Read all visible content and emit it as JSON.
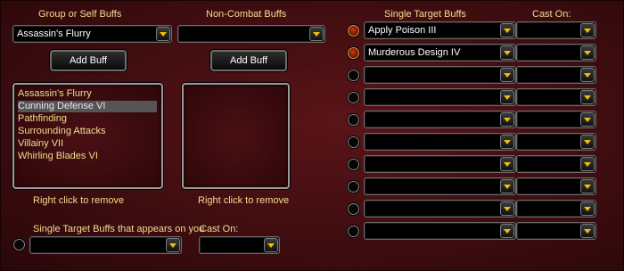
{
  "headers": {
    "group_buffs": "Group or Self Buffs",
    "noncombat_buffs": "Non-Combat Buffs",
    "single_target_buffs": "Single Target Buffs",
    "cast_on": "Cast On:",
    "single_target_on_you": "Single Target Buffs that appears on you",
    "cast_on_bottom": "Cast On:"
  },
  "group_dropdown": {
    "value": "Assassin's Flurry"
  },
  "noncombat_dropdown": {
    "value": ""
  },
  "buttons": {
    "add_buff_group": "Add Buff",
    "add_buff_noncombat": "Add Buff"
  },
  "group_list": {
    "items": [
      "Assassin's Flurry",
      "Cunning Defense VI",
      "Pathfinding",
      "Surrounding Attacks",
      "Villainy VII",
      "Whirling Blades VI"
    ],
    "selected_index": 1
  },
  "noncombat_list": {
    "items": []
  },
  "notes": {
    "remove_left": "Right click to remove",
    "remove_right": "Right click to remove"
  },
  "single_target_rows": [
    {
      "buff": "Apply Poison III",
      "cast_on": "",
      "active": true
    },
    {
      "buff": "Murderous Design IV",
      "cast_on": "",
      "active": true
    },
    {
      "buff": "",
      "cast_on": "",
      "active": false
    },
    {
      "buff": "",
      "cast_on": "",
      "active": false
    },
    {
      "buff": "",
      "cast_on": "",
      "active": false
    },
    {
      "buff": "",
      "cast_on": "",
      "active": false
    },
    {
      "buff": "",
      "cast_on": "",
      "active": false
    },
    {
      "buff": "",
      "cast_on": "",
      "active": false
    },
    {
      "buff": "",
      "cast_on": "",
      "active": false
    },
    {
      "buff": "",
      "cast_on": "",
      "active": false
    }
  ],
  "bottom": {
    "buff_value": "",
    "cast_on_value": ""
  }
}
